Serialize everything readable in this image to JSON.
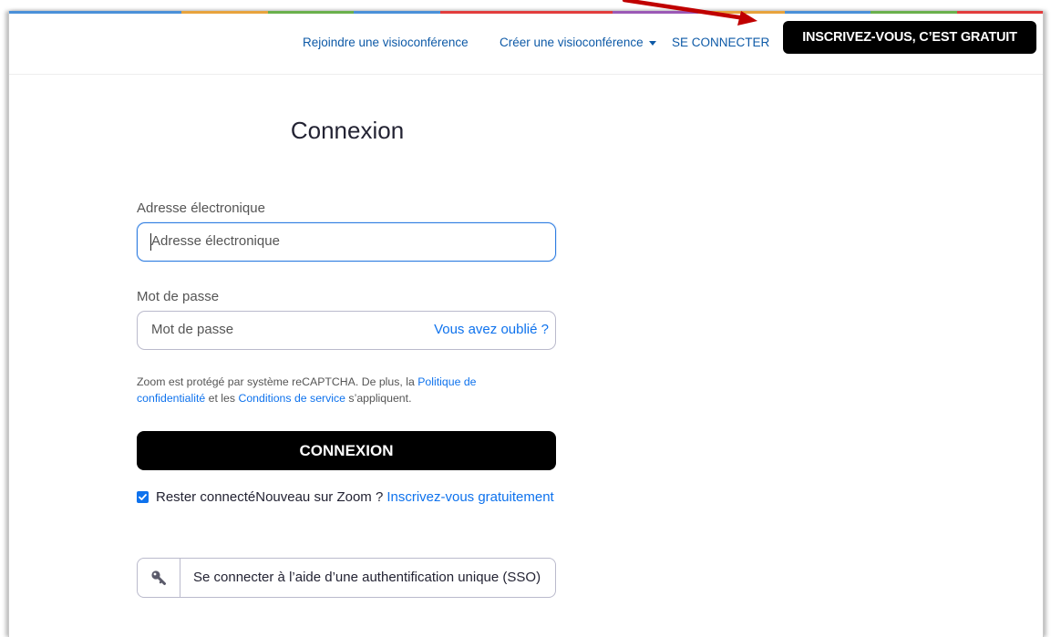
{
  "nav": {
    "join_label": "Rejoindre une visioconférence",
    "host_label": "Créer une visioconférence",
    "signin_label": "SE CONNECTER",
    "signup_label": "INSCRIVEZ-VOUS, C’EST GRATUIT"
  },
  "login": {
    "title": "Connexion",
    "email_label": "Adresse électronique",
    "email_placeholder": "Adresse électronique",
    "password_label": "Mot de passe",
    "password_placeholder": "Mot de passe",
    "forgot_label": "Vous avez oublié ?",
    "recaptcha_prefix": "Zoom est protégé par système reCAPTCHA. De plus, la ",
    "privacy_label": "Politique de confidentialité",
    "recaptcha_middle": " et les ",
    "terms_label": "Conditions de service",
    "recaptcha_suffix": " s’appliquent.",
    "submit_label": "CONNEXION",
    "stay_signed_in_label": "Rester connecté",
    "stay_signed_in_checked": true,
    "new_user_text": "Nouveau sur Zoom ?",
    "signup_free_label": "Inscrivez-vous gratuitement",
    "sso_label": "Se connecter à l’aide d’une authentification unique (SSO)"
  },
  "colors": {
    "brand_blue": "#0e72ed",
    "nav_blue": "#0e5aa7",
    "annotation_arrow": "#c00000",
    "strip": [
      "#4a90d9",
      "#4a90d9",
      "#e8a33d",
      "#6ab04c",
      "#4a90d9",
      "#e23d3d",
      "#e23d3d",
      "#9b59b6",
      "#e8a33d",
      "#4a90d9",
      "#6ab04c",
      "#e23d3d"
    ]
  },
  "icons": {
    "sso": "key-icon",
    "caret": "chevron-down-icon",
    "checkbox": "checkmark-icon"
  }
}
